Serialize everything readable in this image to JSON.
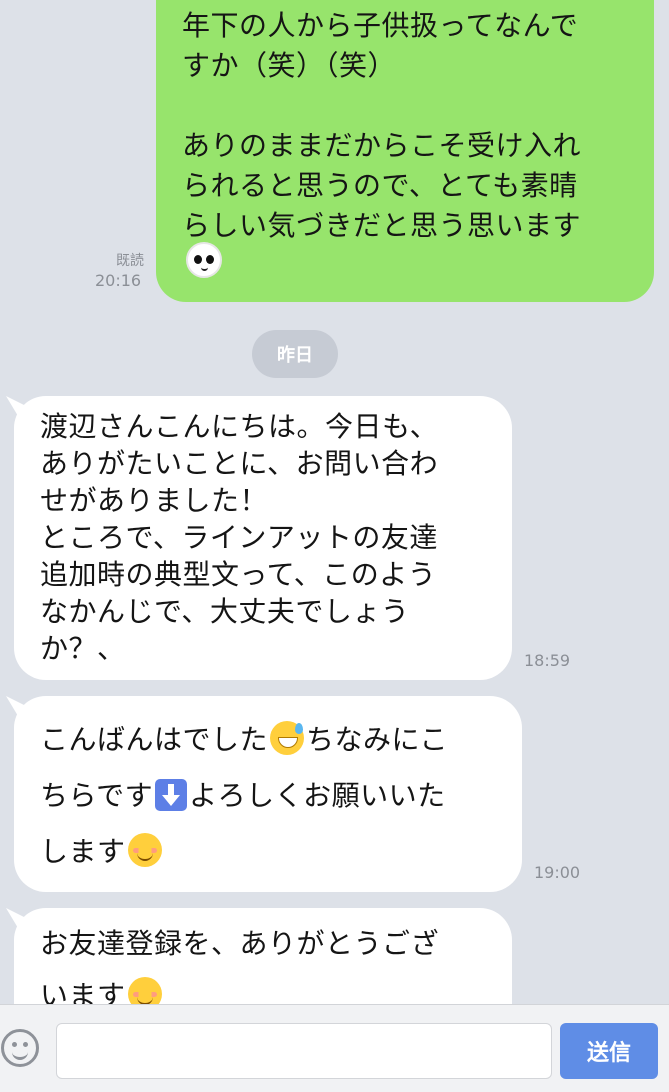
{
  "messages": [
    {
      "direction": "out",
      "text": "年下の人から子供扱ってなんで\nすか（笑）（笑）\n\nありのままだからこそ受け入れ\nられると思うので、とても素晴\nらしい気づきだと思う思います",
      "emoji": "panda-face",
      "read_label": "既読",
      "time": "20:16"
    },
    {
      "direction": "separator",
      "label": "昨日"
    },
    {
      "direction": "in",
      "text": "渡辺さんこんにちは。今日も、\nありがたいことに、お問い合わ\nせがありました！\nところで、ラインアットの友達\n追加時の典型文って、このよう\nなかんじで、大丈夫でしょう\nか？、",
      "time": "18:59"
    },
    {
      "direction": "in",
      "line1a": "こんばんはでした",
      "line1b": "ちなみにこ",
      "line2a": "ちらです",
      "line2b": "よろしくお願いいた",
      "line3": "します",
      "emoji": [
        "grinning-sweat",
        "down-arrow",
        "smiling-face"
      ],
      "time": "19:00"
    },
    {
      "direction": "in",
      "line1": "お友達登録を、ありがとうござ",
      "line2": "います",
      "emoji": "smiling-face"
    }
  ],
  "composer": {
    "placeholder": "",
    "send_label": "送信",
    "emoji_icon": "smiley-icon"
  },
  "colors": {
    "background": "#dde1e8",
    "outgoing": "#97e46c",
    "incoming": "#ffffff",
    "send": "#5f8de6"
  }
}
